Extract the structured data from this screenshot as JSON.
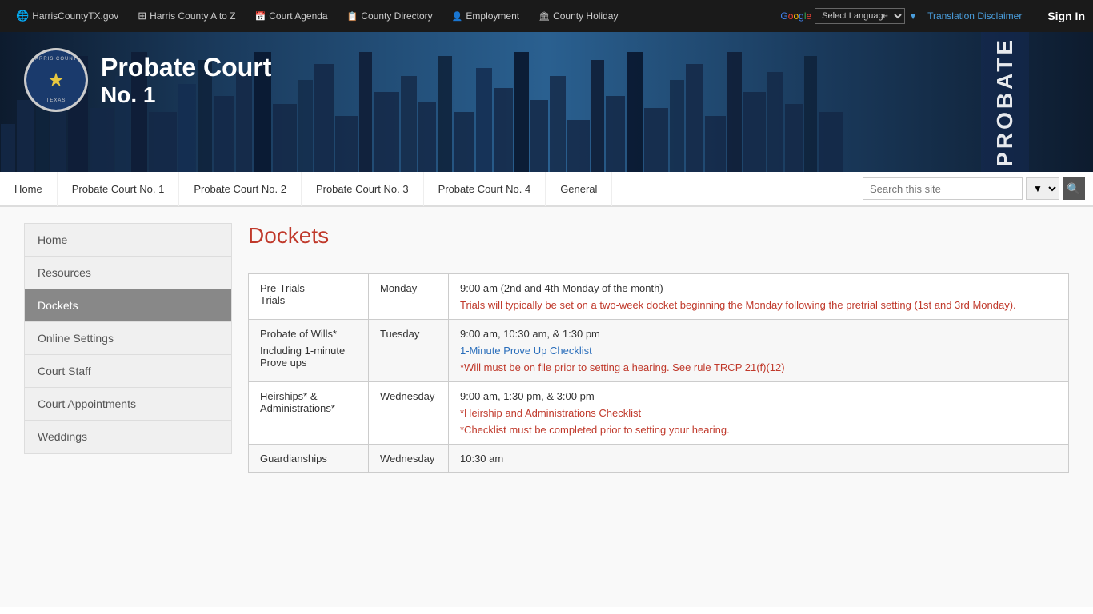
{
  "topbar": {
    "links": [
      {
        "id": "harriscountytx",
        "icon": "globe-icon",
        "label": "HarrisCountyTX.gov"
      },
      {
        "id": "harris-a-to-z",
        "icon": "grid-icon",
        "label": "Harris County A to Z"
      },
      {
        "id": "court-agenda",
        "icon": "calendar-icon",
        "label": "Court Agenda"
      },
      {
        "id": "county-directory",
        "icon": "book-icon",
        "label": "County Directory"
      },
      {
        "id": "employment",
        "icon": "person-icon",
        "label": "Employment"
      },
      {
        "id": "county-holiday",
        "icon": "flag-icon",
        "label": "County Holiday"
      }
    ],
    "select_language": "Select Language",
    "translation_disclaimer": "Translation Disclaimer",
    "sign_in": "Sign In"
  },
  "header": {
    "court_title_line1": "Probate Court",
    "court_title_line2": "No. 1",
    "probate_vertical": "PROBATE"
  },
  "nav": {
    "links": [
      {
        "id": "home",
        "label": "Home"
      },
      {
        "id": "probate-court-1",
        "label": "Probate Court No. 1"
      },
      {
        "id": "probate-court-2",
        "label": "Probate Court No. 2"
      },
      {
        "id": "probate-court-3",
        "label": "Probate Court No. 3"
      },
      {
        "id": "probate-court-4",
        "label": "Probate Court No. 4"
      },
      {
        "id": "general",
        "label": "General"
      }
    ],
    "search_placeholder": "Search this site"
  },
  "sidebar": {
    "items": [
      {
        "id": "home",
        "label": "Home",
        "active": false
      },
      {
        "id": "resources",
        "label": "Resources",
        "active": false
      },
      {
        "id": "dockets",
        "label": "Dockets",
        "active": true
      },
      {
        "id": "online-settings",
        "label": "Online Settings",
        "active": false
      },
      {
        "id": "court-staff",
        "label": "Court Staff",
        "active": false
      },
      {
        "id": "court-appointments",
        "label": "Court Appointments",
        "active": false
      },
      {
        "id": "weddings",
        "label": "Weddings",
        "active": false
      }
    ]
  },
  "main": {
    "page_title": "Dockets",
    "table": {
      "rows": [
        {
          "type": "Pre-Trials\nTrials",
          "day": "Monday",
          "details_plain": "9:00 am (2nd and 4th Monday of the month)",
          "details_red": "Trials will typically be set on a two-week docket beginning the Monday following the pretrial setting (1st and 3rd Monday).",
          "has_red": true,
          "has_link": false
        },
        {
          "type": "Probate of Wills*\nIncluding 1-minute\nProve ups",
          "day": "Tuesday",
          "details_plain": "9:00 am, 10:30 am, & 1:30 pm",
          "link_text": "1-Minute Prove Up Checklist",
          "link_url": "#",
          "details_red2": "*Will must be on file prior to setting a hearing. See rule TRCP 21(f)(12)",
          "has_red": false,
          "has_link": true,
          "has_red2": true
        },
        {
          "type": "Heirships* &\nAdministrations*",
          "day": "Wednesday",
          "details_plain": "9:00 am,  1:30 pm, & 3:00 pm",
          "link_text": "*Heirship and Administrations Checklist",
          "link_url": "#",
          "details_red2": "*Checklist must be completed prior to setting your hearing.",
          "has_red": false,
          "has_link": true,
          "has_red2": true,
          "link_red": true
        },
        {
          "type": "Guardianships",
          "day": "Wednesday",
          "details_plain": "10:30 am",
          "has_red": false,
          "has_link": false
        }
      ]
    }
  }
}
